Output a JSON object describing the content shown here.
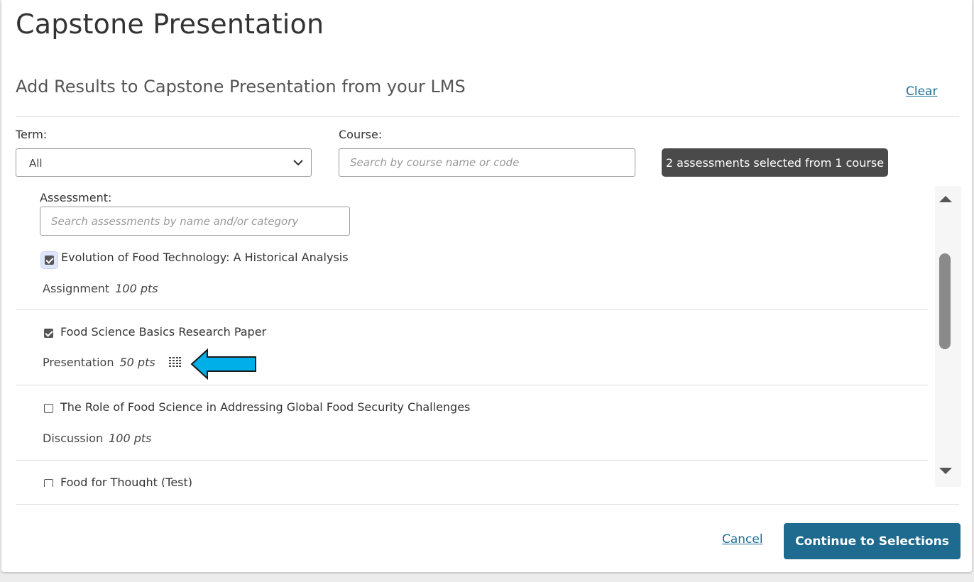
{
  "dialog": {
    "title": "Capstone Presentation",
    "subtitle": "Add Results to Capstone Presentation from your LMS",
    "clear_label": "Clear"
  },
  "filters": {
    "term_label": "Term:",
    "term_value": "All",
    "course_label": "Course:",
    "course_placeholder": "Search by course name or code",
    "selection_badge": "2 assessments selected from 1 course",
    "assessment_label": "Assessment:",
    "assessment_placeholder": "Search assessments by name and/or category"
  },
  "assessments": [
    {
      "title": "Evolution of Food Technology: A Historical Analysis",
      "category": "Assignment",
      "points": "100 pts",
      "checked": true
    },
    {
      "title": "Food Science Basics Research Paper",
      "category": "Presentation",
      "points": "50 pts",
      "checked": true,
      "has_rubric_icon": true
    },
    {
      "title": "The Role of Food Science in Addressing Global Food Security Challenges",
      "category": "Discussion",
      "points": "100 pts",
      "checked": false
    },
    {
      "title": "Food for Thought (Test)",
      "checked": false
    }
  ],
  "footer": {
    "cancel_label": "Cancel",
    "continue_label": "Continue to Selections"
  },
  "colors": {
    "link": "#1a6e94",
    "primary_button": "#1f6b8f",
    "badge_bg": "#4a4a4a",
    "callout_arrow": "#00aee8"
  },
  "icons": [
    "chevron-down-icon",
    "checkbox-icon",
    "rubric-grid-icon",
    "callout-arrow-icon",
    "scroll-up-icon",
    "scroll-down-icon"
  ]
}
